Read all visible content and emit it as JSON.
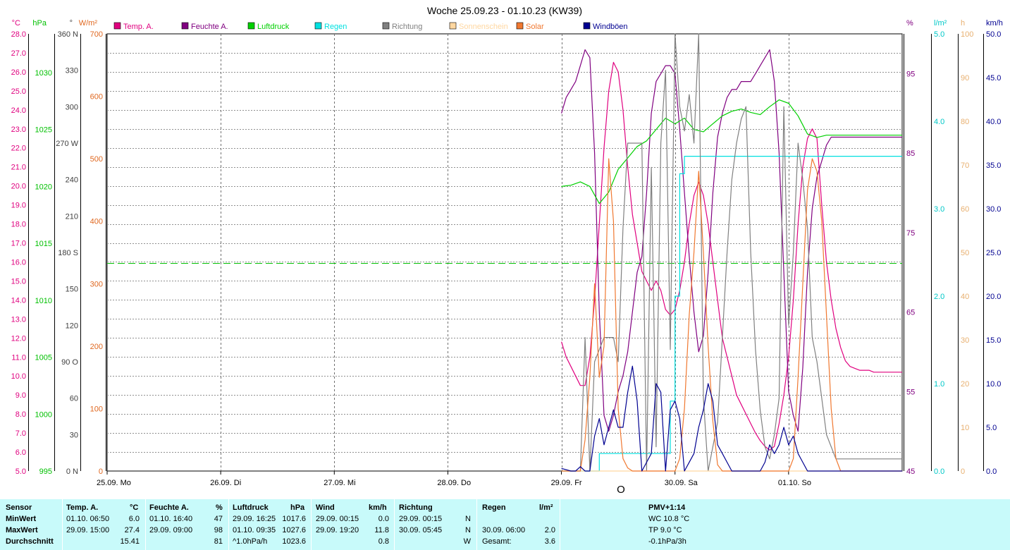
{
  "chart_data": {
    "type": "line",
    "title": "Woche 25.09.23 - 01.10.23 (KW39)",
    "x_labels": [
      "25.09.  Mo",
      "26.09.  Di",
      "27.09.  Mi",
      "28.09.  Do",
      "29.09.  Fr",
      "30.09.  Sa",
      "01.10.  So"
    ],
    "x_start_label": "25.09. 00:00",
    "x_unit": "hours since start of week",
    "x_range": [
      0,
      168
    ],
    "axes": {
      "temp": {
        "unit": "°C",
        "range": [
          5,
          28
        ],
        "ticks": [
          "5.0",
          "6.0",
          "7.0",
          "8.0",
          "9.0",
          "10.0",
          "11.0",
          "12.0",
          "13.0",
          "14.0",
          "15.0",
          "16.0",
          "17.0",
          "18.0",
          "19.0",
          "20.0",
          "21.0",
          "22.0",
          "23.0",
          "24.0",
          "25.0",
          "26.0",
          "27.0",
          "28.0"
        ]
      },
      "pressure": {
        "unit": "hPa",
        "range": [
          995,
          1033.4
        ],
        "ticks": [
          "995",
          "1000",
          "1005",
          "1010",
          "1015",
          "1020",
          "1025",
          "1030"
        ]
      },
      "direction": {
        "unit": "°",
        "range": [
          0,
          360
        ],
        "ticks": [
          "0 N",
          "30",
          "60",
          "90  O",
          "120",
          "150",
          "180 S",
          "210",
          "240",
          "270 W",
          "300",
          "330",
          "360 N"
        ]
      },
      "solar": {
        "unit": "W/m²",
        "range": [
          0,
          700
        ],
        "ticks": [
          "0",
          "100",
          "200",
          "300",
          "400",
          "500",
          "600",
          "700"
        ]
      },
      "humidity": {
        "unit": "%",
        "range": [
          45,
          100
        ],
        "ticks": [
          "45",
          "55",
          "65",
          "75",
          "85",
          "95"
        ]
      },
      "rain": {
        "unit": "l/m²",
        "range": [
          0,
          5
        ],
        "ticks": [
          "0.0",
          "1.0",
          "2.0",
          "3.0",
          "4.0",
          "5.0"
        ]
      },
      "sunshine": {
        "unit": "h",
        "range": [
          0,
          100
        ],
        "ticks": [
          "0",
          "10",
          "20",
          "30",
          "40",
          "50",
          "60",
          "70",
          "80",
          "90",
          "100"
        ]
      },
      "wind": {
        "unit": "km/h",
        "range": [
          0,
          50
        ],
        "ticks": [
          "0.0",
          "5.0",
          "10.0",
          "15.0",
          "20.0",
          "25.0",
          "30.0",
          "35.0",
          "40.0",
          "45.0",
          "50.0"
        ]
      }
    },
    "reference_line": {
      "axis": "pressure",
      "value": 1013.3,
      "color": "#00c000"
    },
    "series": [
      {
        "name": "Temp. A.",
        "color": "#e0007f",
        "axis": "temp",
        "x": [
          96,
          97,
          98,
          99,
          100,
          101,
          102,
          103,
          104,
          105,
          106,
          107,
          108,
          109,
          110,
          111,
          112,
          113,
          114,
          115,
          116,
          117,
          118,
          119,
          120,
          121,
          122,
          123,
          124,
          125,
          126,
          127,
          128,
          129,
          130,
          131,
          132,
          133,
          134,
          135,
          136,
          137,
          138,
          139,
          140,
          141,
          142,
          143,
          144,
          145,
          146,
          147,
          148,
          149,
          150,
          151,
          152,
          153,
          154,
          155,
          156,
          157,
          158,
          159,
          160,
          161,
          162,
          163,
          164,
          165,
          166,
          167,
          168
        ],
        "y": [
          11.8,
          11.0,
          10.5,
          10.0,
          9.5,
          9.5,
          11,
          14,
          18,
          22,
          25,
          26.5,
          26,
          24,
          21,
          18.5,
          17,
          15.5,
          15,
          14.5,
          15,
          14.5,
          13.5,
          13.2,
          13.5,
          14.5,
          16,
          18,
          19.5,
          20.2,
          19.5,
          18,
          16,
          14,
          12,
          11,
          10,
          9,
          8.5,
          8,
          7.5,
          7,
          6.6,
          6.3,
          6.1,
          6.3,
          7.5,
          9,
          11,
          14,
          18,
          21,
          22.5,
          23,
          22.5,
          19,
          16,
          14,
          12.5,
          11.5,
          10.8,
          10.5,
          10.4,
          10.3,
          10.3,
          10.3,
          10.2,
          10.2,
          10.2,
          10.2,
          10.2,
          10.2,
          10.2
        ]
      },
      {
        "name": "Feuchte A.",
        "color": "#800080",
        "axis": "humidity",
        "x": [
          96,
          97,
          98,
          99,
          100,
          101,
          102,
          103,
          104,
          105,
          106,
          107,
          108,
          109,
          110,
          111,
          112,
          113,
          114,
          115,
          116,
          117,
          118,
          119,
          120,
          121,
          122,
          123,
          124,
          125,
          126,
          127,
          128,
          129,
          130,
          131,
          132,
          133,
          134,
          135,
          136,
          137,
          138,
          139,
          140,
          141,
          142,
          143,
          144,
          145,
          146,
          147,
          148,
          149,
          150,
          151,
          152,
          153,
          154,
          155,
          156,
          157,
          158,
          159,
          160,
          161,
          162,
          163,
          164,
          165,
          166,
          167,
          168
        ],
        "y": [
          90,
          92,
          93,
          94,
          96,
          98,
          97,
          85,
          65,
          52,
          50,
          52,
          55,
          57,
          60,
          65,
          70,
          72,
          80,
          90,
          94,
          95,
          96,
          96,
          95,
          88,
          80,
          72,
          65,
          60,
          62,
          70,
          80,
          87,
          90,
          92,
          93,
          93,
          94,
          94,
          94,
          95,
          96,
          97,
          98,
          94,
          85,
          70,
          55,
          52,
          50,
          58,
          70,
          78,
          82,
          84,
          86,
          87,
          87,
          87,
          87,
          87,
          87,
          87,
          87,
          87,
          87,
          87,
          87,
          87,
          87,
          87,
          87
        ]
      },
      {
        "name": "Luftdruck",
        "color": "#00d000",
        "axis": "pressure",
        "x": [
          96,
          98,
          100,
          102,
          104,
          106,
          108,
          110,
          112,
          114,
          116,
          118,
          120,
          122,
          124,
          126,
          128,
          130,
          132,
          134,
          136,
          138,
          140,
          142,
          144,
          146,
          148,
          150,
          152,
          154,
          156,
          158,
          160,
          162,
          164,
          166,
          168
        ],
        "y": [
          1020,
          1020.1,
          1020.4,
          1020.0,
          1018.5,
          1019.5,
          1021.5,
          1022.5,
          1023.5,
          1024,
          1025,
          1026,
          1025.5,
          1026,
          1025,
          1024.8,
          1025.5,
          1026.2,
          1026.6,
          1026.8,
          1026.5,
          1026.3,
          1027,
          1027.6,
          1027.3,
          1026.2,
          1024.6,
          1024.3,
          1024.5,
          1024.5,
          1024.5,
          1024.5,
          1024.5,
          1024.5,
          1024.5,
          1024.5,
          1024.5
        ]
      },
      {
        "name": "Regen",
        "color": "#00e0e0",
        "axis": "rain",
        "step": true,
        "x": [
          96,
          103,
          104,
          108,
          117,
          119,
          120,
          121,
          122,
          123,
          124,
          125,
          168
        ],
        "y": [
          0.0,
          0.0,
          0.2,
          0.2,
          0.2,
          0.8,
          2.0,
          3.4,
          3.6,
          3.6,
          3.6,
          3.6,
          3.6
        ]
      },
      {
        "name": "Richtung",
        "color": "#808080",
        "axis": "direction",
        "x": [
          96,
          100,
          101,
          102,
          103,
          104,
          105,
          106,
          107,
          108,
          109,
          110,
          111,
          112,
          113,
          114,
          115,
          116,
          117,
          118,
          119,
          120,
          121,
          122,
          123,
          124,
          125,
          126,
          127,
          128,
          129,
          130,
          131,
          132,
          133,
          134,
          135,
          136,
          137,
          138,
          139,
          140,
          141,
          142,
          143,
          144,
          145,
          146,
          147,
          148,
          149,
          150,
          151,
          152,
          153,
          154,
          155,
          156,
          157,
          158,
          159,
          160,
          161,
          162,
          163,
          164,
          165,
          166,
          167,
          168
        ],
        "y": [
          0,
          0,
          110,
          0,
          90,
          100,
          110,
          110,
          110,
          90,
          200,
          270,
          270,
          270,
          270,
          0,
          250,
          20,
          270,
          330,
          100,
          360,
          300,
          280,
          310,
          270,
          360,
          60,
          0,
          20,
          40,
          110,
          180,
          240,
          270,
          290,
          300,
          180,
          100,
          50,
          20,
          10,
          30,
          60,
          300,
          120,
          180,
          270,
          240,
          200,
          110,
          90,
          60,
          30,
          20,
          10,
          10,
          10,
          10,
          10,
          10,
          10,
          10,
          10,
          10,
          10,
          10,
          10,
          10,
          10
        ]
      },
      {
        "name": "Sonnenschein",
        "color": "#ffd7a0",
        "axis": "sunshine",
        "x": [
          96,
          168
        ],
        "y": [
          0,
          0
        ]
      },
      {
        "name": "Solar",
        "color": "#f07830",
        "axis": "solar",
        "x": [
          96,
          100,
          101,
          102,
          103,
          104,
          105,
          106,
          107,
          108,
          109,
          110,
          111,
          112,
          113,
          114,
          115,
          116,
          117,
          118,
          119,
          120,
          121,
          122,
          123,
          124,
          125,
          126,
          127,
          128,
          129,
          130,
          131,
          132,
          133,
          134,
          135,
          136,
          137,
          138,
          139,
          140,
          141,
          142,
          143,
          144,
          145,
          146,
          147,
          148,
          149,
          150,
          151,
          152,
          153,
          154,
          155,
          156,
          157,
          158,
          159,
          160,
          161,
          162,
          163,
          164,
          165,
          166,
          167,
          168
        ],
        "y": [
          0,
          0,
          50,
          150,
          300,
          150,
          200,
          500,
          400,
          100,
          20,
          5,
          0,
          0,
          0,
          0,
          0,
          0,
          0,
          0,
          0,
          0,
          20,
          100,
          250,
          350,
          480,
          350,
          200,
          80,
          10,
          0,
          0,
          0,
          0,
          0,
          0,
          0,
          0,
          0,
          0,
          0,
          0,
          0,
          0,
          0,
          20,
          150,
          300,
          450,
          500,
          480,
          400,
          250,
          100,
          20,
          0,
          0,
          0,
          0,
          0,
          0,
          0,
          0,
          0,
          0,
          0,
          0,
          0,
          0
        ]
      },
      {
        "name": "Windböen",
        "color": "#000090",
        "axis": "wind",
        "x": [
          96,
          98,
          99,
          100,
          101,
          102,
          103,
          104,
          105,
          106,
          107,
          108,
          109,
          110,
          111,
          112,
          113,
          114,
          115,
          116,
          117,
          118,
          119,
          120,
          121,
          122,
          123,
          124,
          125,
          126,
          127,
          128,
          129,
          130,
          131,
          132,
          133,
          134,
          135,
          136,
          137,
          138,
          139,
          140,
          141,
          142,
          143,
          144,
          145,
          146,
          147,
          148,
          149,
          150,
          151,
          152,
          153,
          154,
          155,
          156,
          157,
          158,
          159,
          160,
          161,
          162,
          163,
          164,
          165,
          166,
          167,
          168
        ],
        "y": [
          0.3,
          0,
          0,
          0.5,
          0,
          0,
          4,
          6,
          3,
          5,
          7,
          5,
          5,
          9,
          12,
          8,
          0,
          1,
          2,
          10,
          9,
          0,
          7,
          8,
          6,
          0,
          1,
          2,
          5,
          7,
          10,
          8,
          3,
          2,
          1,
          0,
          0,
          0,
          0,
          0,
          0,
          0,
          1,
          3,
          2,
          3,
          5,
          3,
          4,
          2,
          1,
          0,
          0,
          0,
          0,
          0,
          0,
          0,
          0,
          0,
          0,
          0,
          0,
          0,
          0,
          0,
          0,
          0,
          0,
          0,
          0,
          0
        ]
      }
    ]
  },
  "legend": [
    {
      "label": "Temp. A.",
      "color": "#e0007f"
    },
    {
      "label": "Feuchte A.",
      "color": "#800080"
    },
    {
      "label": "Luftdruck",
      "color": "#00d000"
    },
    {
      "label": "Regen",
      "color": "#00e0e0"
    },
    {
      "label": "Richtung",
      "color": "#808080"
    },
    {
      "label": "Sonnenschein",
      "color": "#ffd7a0"
    },
    {
      "label": "Solar",
      "color": "#f07830"
    },
    {
      "label": "Windböen",
      "color": "#000090"
    }
  ],
  "axis_headers": {
    "temp": "°C",
    "pressure": "hPa",
    "direction": "°",
    "solar": "W/m²",
    "humidity": "%",
    "rain": "l/m²",
    "sunshine": "h",
    "wind": "km/h"
  },
  "wind_direction_marker": "O",
  "stats": {
    "headers": {
      "sensor": "Sensor",
      "temp": "Temp. A.",
      "temp_unit": "°C",
      "hum": "Feuchte A.",
      "hum_unit": "%",
      "press": "Luftdruck",
      "press_unit": "hPa",
      "wind": "Wind",
      "wind_unit": "km/h",
      "dir": "Richtung",
      "rain": "Regen",
      "rain_unit": "l/m²",
      "pmv": "PMV+1:14"
    },
    "min": {
      "label": "MinWert",
      "temp_time": "01.10.  06:50",
      "temp_val": "6.0",
      "hum_time": "01.10.  16:40",
      "hum_val": "47",
      "press_time": "29.09.  16:25",
      "press_val": "1017.6",
      "wind_time": "29.09.  00:15",
      "wind_val": "0.0",
      "dir_time": "29.09.  00:15",
      "dir_val": "N",
      "pmv_text": "WC 10.8 °C"
    },
    "max": {
      "label": "MaxWert",
      "temp_time": "29.09.  15:00",
      "temp_val": "27.4",
      "hum_time": "29.09.  09:00",
      "hum_val": "98",
      "press_time": "01.10.  09:35",
      "press_val": "1027.6",
      "wind_time": "29.09.  19:20",
      "wind_val": "11.8",
      "dir_time": "30.09.  05:45",
      "dir_val": "N",
      "rain_time": "30.09.  06:00",
      "rain_val": "2.0",
      "pmv_text": "TP 9.0 °C"
    },
    "avg": {
      "label": "Durchschnitt",
      "temp_val": "15.41",
      "hum_val": "81",
      "press_trend": "^1.0hPa/h",
      "press_val": "1023.6",
      "wind_val": "0.8",
      "dir_val": "W",
      "rain_label": "Gesamt:",
      "rain_val": "3.6",
      "pmv_text": "-0.1hPa/3h"
    }
  }
}
